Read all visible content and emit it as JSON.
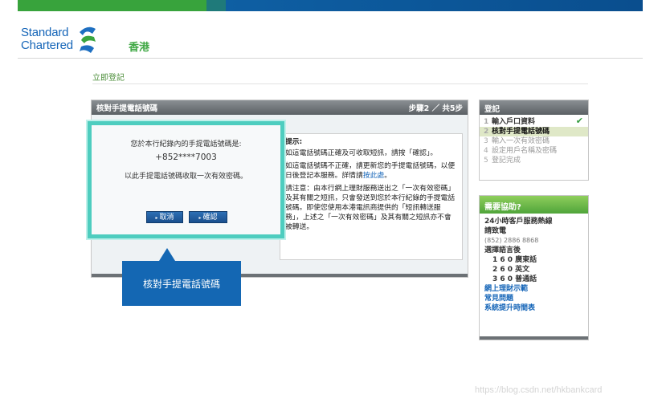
{
  "brand": {
    "name_line1": "Standard",
    "name_line2": "Chartered",
    "region": "香港",
    "colors": {
      "green": "#38a33c",
      "blue": "#1467b3",
      "teal": "#4ecdbf"
    }
  },
  "breadcrumb": "立即登記",
  "panel": {
    "title": "核對手提電話號碼",
    "step_indicator": "步驟2 ／ 共5步"
  },
  "dialog": {
    "line1": "您於本行紀錄內的手提電話號碼是:",
    "phone": "+852****7003",
    "line3": "以此手提電話號碼收取一次有效密碼。",
    "cancel_label": "取消",
    "confirm_label": "確認"
  },
  "hint": {
    "title": "提示:",
    "para1": "如這電話號碼正確及可收取短訊，請按「確認」。",
    "para2_before": "如這電話號碼不正確，請更新您的手提電話號碼，以便日後登記本服務。詳情請",
    "para2_link": "按此處",
    "para2_after": "。",
    "para3": "請注意：由本行網上理財服務送出之「一次有效密碼」及其有關之短訊，只會發送到您於本行紀錄的手提電話號碼。即使您使用本港電訊商提供的「短訊轉送服務」，上述之「一次有效密碼」及其有關之短訊亦不會被轉送。"
  },
  "callout": "核對手提電話號碼",
  "steps": {
    "title": "登記",
    "items": [
      {
        "num": "1",
        "label": "輸入戶口資料"
      },
      {
        "num": "2",
        "label": "核對手提電話號碼"
      },
      {
        "num": "3",
        "label": "輸入一次有效密碼"
      },
      {
        "num": "4",
        "label": "設定用戶名稱及密碼"
      },
      {
        "num": "5",
        "label": "登記完成"
      }
    ]
  },
  "help": {
    "title": "需要協助?",
    "hotline": "24小時客戶服務熱線",
    "call": "請致電",
    "phone": "(852) 2886 8868",
    "language": "選擇語言後",
    "lang1": "1 6 0 廣東話",
    "lang2": "2 6 0 英文",
    "lang3": "3 6 0 普通話",
    "links": [
      "網上理財示範",
      "常見問題",
      "系統提升時間表"
    ]
  },
  "watermark": "https://blog.csdn.net/hkbankcard"
}
